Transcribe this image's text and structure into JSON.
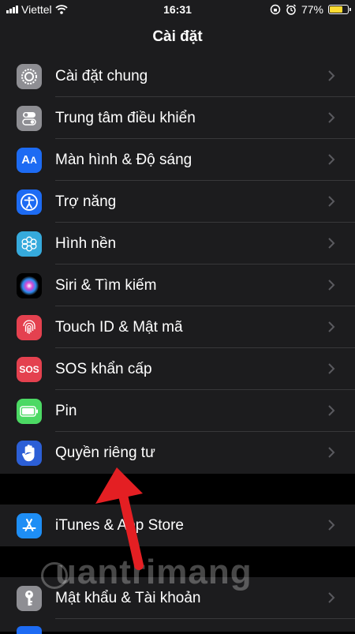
{
  "status_bar": {
    "carrier": "Viettel",
    "time": "16:31",
    "battery_percent": "77%",
    "battery_level": 0.77,
    "battery_color": "#fedc32"
  },
  "nav": {
    "title": "Cài đặt"
  },
  "groups": [
    {
      "items": [
        {
          "label": "Cài đặt chung",
          "icon": "gear-icon",
          "color": "#8e8e93"
        },
        {
          "label": "Trung tâm điều khiển",
          "icon": "toggle-switches-icon",
          "color": "#8e8e93"
        },
        {
          "label": "Màn hình & Độ sáng",
          "icon": "text-size-icon",
          "color": "#1d6bf3"
        },
        {
          "label": "Trợ năng",
          "icon": "accessibility-icon",
          "color": "#1d6bf3"
        },
        {
          "label": "Hình nền",
          "icon": "flower-icon",
          "color": "#36aadc"
        },
        {
          "label": "Siri & Tìm kiếm",
          "icon": "siri-icon",
          "color": "#000000"
        },
        {
          "label": "Touch ID & Mật mã",
          "icon": "fingerprint-icon",
          "color": "#e4414f"
        },
        {
          "label": "SOS khẩn cấp",
          "icon": "sos-icon",
          "color": "#e4414f",
          "icon_text": "SOS"
        },
        {
          "label": "Pin",
          "icon": "battery-icon",
          "color": "#4cd964"
        },
        {
          "label": "Quyền riêng tư",
          "icon": "hand-icon",
          "color": "#2c5fd6"
        }
      ]
    },
    {
      "items": [
        {
          "label": "iTunes & App Store",
          "icon": "app-store-icon",
          "color": "#1e8ef5"
        }
      ]
    },
    {
      "items": [
        {
          "label": "Mật khẩu & Tài khoản",
          "icon": "key-icon",
          "color": "#8e8e93"
        }
      ]
    }
  ],
  "watermark": {
    "text": "uantrimang"
  }
}
